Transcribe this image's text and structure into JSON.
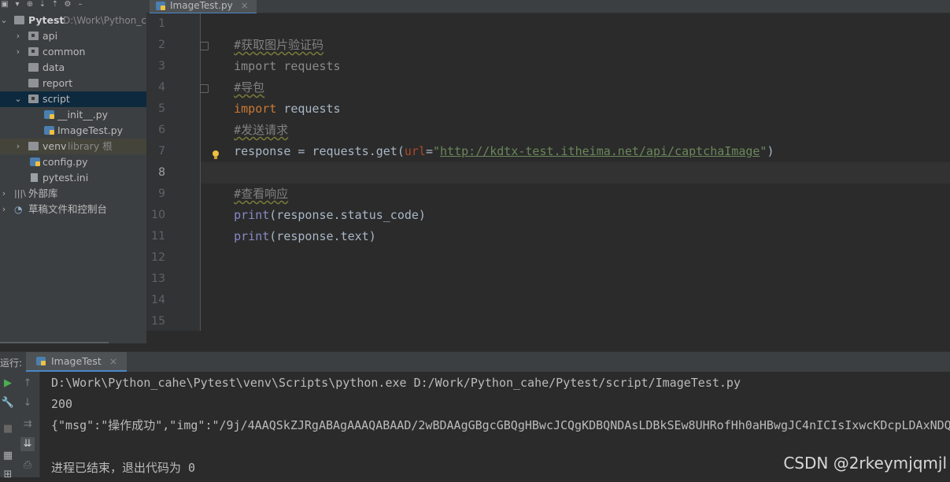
{
  "tab_bar": {
    "file_tab": "ImageTest.py",
    "close": "×"
  },
  "project": {
    "root_name": "Pytest",
    "root_path": "D:\\Work\\Python_c",
    "items": [
      {
        "name": "api",
        "type": "folder"
      },
      {
        "name": "common",
        "type": "folder"
      },
      {
        "name": "data",
        "type": "folder"
      },
      {
        "name": "report",
        "type": "folder"
      },
      {
        "name": "script",
        "type": "folder"
      },
      {
        "name": "__init__.py",
        "type": "py"
      },
      {
        "name": "ImageTest.py",
        "type": "py"
      },
      {
        "name": "venv",
        "type": "folder",
        "note": "library 根"
      },
      {
        "name": "config.py",
        "type": "py"
      },
      {
        "name": "pytest.ini",
        "type": "ini"
      },
      {
        "name": "外部库",
        "type": "lib"
      },
      {
        "name": "草稿文件和控制台",
        "type": "scratch"
      }
    ]
  },
  "editor": {
    "line_numbers": [
      "1",
      "2",
      "3",
      "4",
      "5",
      "6",
      "7",
      "8",
      "9",
      "10",
      "11",
      "12",
      "13",
      "14",
      "15"
    ],
    "current_line": "8",
    "code": {
      "l1": "#获取图片验证码",
      "l2_kw": "import",
      "l2_rest": " requests",
      "l3": "#导包",
      "l4_kw": "import",
      "l4_rest": " requests",
      "l5": "#发送请求",
      "l6_a": "response = requests.get(",
      "l6_param": "url",
      "l6_eq": "=",
      "l6_q1": "\"",
      "l6_url": "http://kdtx-test.itheima.net/api/captchaImage",
      "l6_q2": "\"",
      "l6_end": ")",
      "l8": "#查看响应",
      "l9_fn": "print",
      "l9_rest": "(response.status_code)",
      "l10_fn": "print",
      "l10_rest": "(response.text)"
    }
  },
  "run": {
    "title": "运行:",
    "tab_label": "ImageTest",
    "close": "×",
    "output": [
      "D:\\Work\\Python_cahe\\Pytest\\venv\\Scripts\\python.exe D:/Work/Python_cahe/Pytest/script/ImageTest.py",
      "200",
      "{\"msg\":\"操作成功\",\"img\":\"/9j/4AAQSkZJRgABAgAAAQABAAD/2wBDAAgGBgcGBQgHBwcJCQgKDBQNDAsLDBkSEw8UHRofHh0aHBwgJC4nICIsIxwcKDcpLDAxNDQ0",
      "",
      "进程已结束，退出代码为 0"
    ]
  },
  "watermark": "CSDN @2rkeymjqmjl"
}
